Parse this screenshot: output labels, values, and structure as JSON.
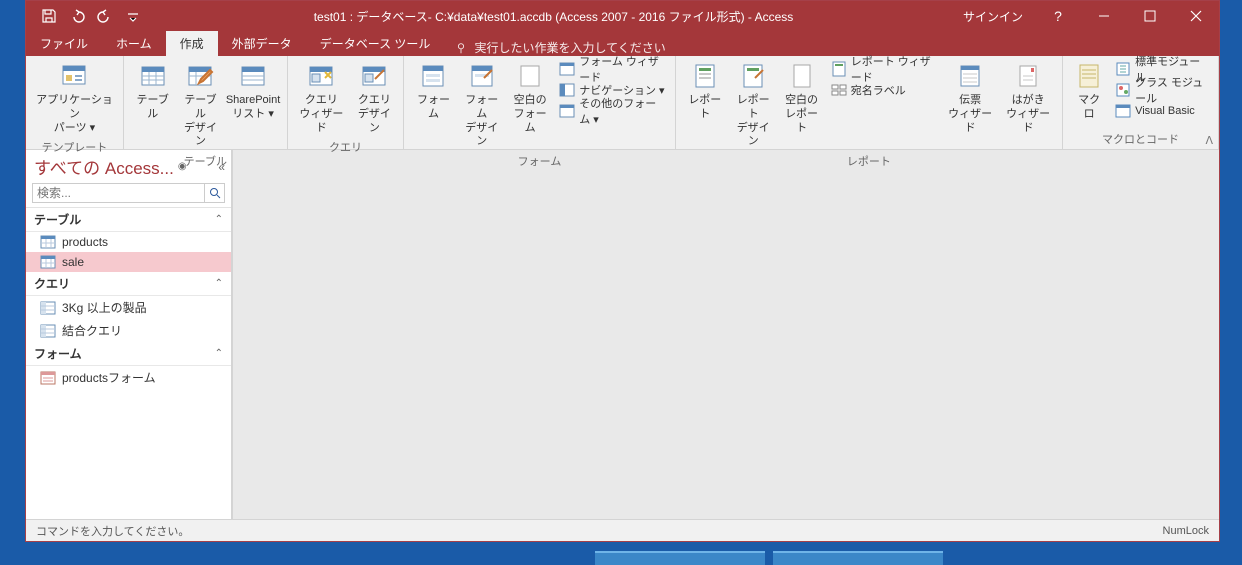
{
  "titlebar": {
    "title": "test01 : データベース- C:¥data¥test01.accdb (Access 2007 - 2016 ファイル形式) - Access",
    "signin": "サインイン"
  },
  "tabs": {
    "file": "ファイル",
    "home": "ホーム",
    "create": "作成",
    "external": "外部データ",
    "dbtools": "データベース ツール",
    "tellme": "実行したい作業を入力してください"
  },
  "ribbon": {
    "templates": {
      "label": "テンプレート",
      "appparts": "アプリケーション\nパーツ ▾"
    },
    "tables": {
      "label": "テーブル",
      "table": "テーブル",
      "tabledesign": "テーブル\nデザイン",
      "sharepoint": "SharePoint\nリスト ▾"
    },
    "queries": {
      "label": "クエリ",
      "wizard": "クエリ\nウィザード",
      "design": "クエリ\nデザイン"
    },
    "forms": {
      "label": "フォーム",
      "form": "フォーム",
      "formdesign": "フォーム\nデザイン",
      "blank": "空白の\nフォーム",
      "formwizard": "フォーム ウィザード",
      "nav": "ナビゲーション ▾",
      "other": "その他のフォーム ▾"
    },
    "reports": {
      "label": "レポート",
      "report": "レポート",
      "reportdesign": "レポート\nデザイン",
      "blank": "空白の\nレポート",
      "reportwizard": "レポート ウィザード",
      "labels": "宛名ラベル",
      "denpyo": "伝票\nウィザード",
      "hagaki": "はがき\nウィザード"
    },
    "macros": {
      "label": "マクロとコード",
      "macro": "マクロ",
      "stdmodule": "標準モジュール",
      "classmodule": "クラス モジュール",
      "vb": "Visual Basic"
    }
  },
  "nav": {
    "title": "すべての Access...",
    "search_ph": "検索...",
    "cat_tables": "テーブル",
    "cat_queries": "クエリ",
    "cat_forms": "フォーム",
    "items": {
      "products": "products",
      "sale": "sale",
      "q1": "3Kg 以上の製品",
      "q2": "結合クエリ",
      "f1": "productsフォーム"
    }
  },
  "status": {
    "left": "コマンドを入力してください。",
    "right": "NumLock"
  }
}
